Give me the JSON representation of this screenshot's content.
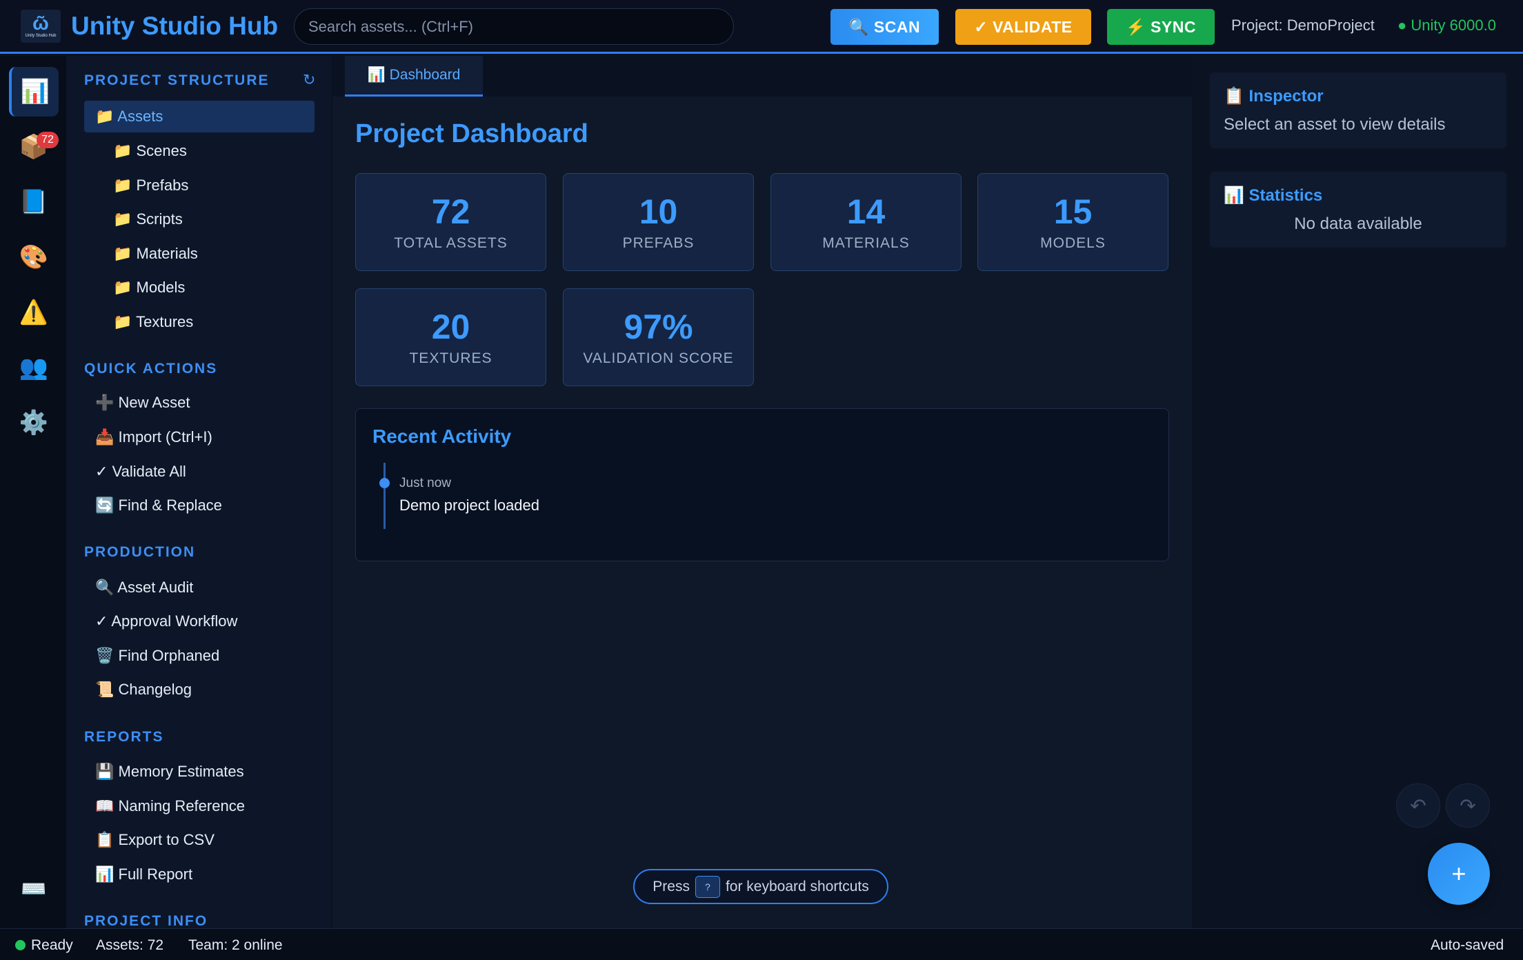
{
  "header": {
    "logo_text": "Unity Studio Hub",
    "title": "Unity Studio Hub",
    "search_placeholder": "Search assets... (Ctrl+F)",
    "scan_label": "🔍 SCAN",
    "validate_label": "✓ VALIDATE",
    "sync_label": "⚡ SYNC",
    "project": "Project: DemoProject",
    "unity_version": "● Unity 6000.0"
  },
  "rail": {
    "items": [
      {
        "icon": "📊",
        "name": "dashboard-icon"
      },
      {
        "icon": "📦",
        "name": "assets-icon",
        "badge": "72"
      },
      {
        "icon": "📘",
        "name": "docs-icon"
      },
      {
        "icon": "🎨",
        "name": "palette-icon"
      },
      {
        "icon": "⚠️",
        "name": "warning-icon"
      },
      {
        "icon": "👥",
        "name": "team-icon"
      },
      {
        "icon": "⚙️",
        "name": "gear-icon"
      }
    ],
    "keyboard_icon": "⌨️"
  },
  "sidebar": {
    "project_structure_title": "PROJECT STRUCTURE",
    "refresh_icon": "↻",
    "tree": [
      "📁 Assets",
      "📁 Scenes",
      "📁 Prefabs",
      "📁 Scripts",
      "📁 Materials",
      "📁 Models",
      "📁 Textures"
    ],
    "quick_actions_title": "QUICK ACTIONS",
    "quick_actions": [
      "➕ New Asset",
      "📥 Import (Ctrl+I)",
      "✓ Validate All",
      "🔄 Find & Replace"
    ],
    "production_title": "PRODUCTION",
    "production": [
      "🔍 Asset Audit",
      "✓ Approval Workflow",
      "🗑️ Find Orphaned",
      "📜 Changelog"
    ],
    "reports_title": "REPORTS",
    "reports": [
      "💾 Memory Estimates",
      "📖 Naming Reference",
      "📋 Export to CSV",
      "📊 Full Report"
    ],
    "project_info_title": "PROJECT INFO"
  },
  "main": {
    "tab_label": "📊 Dashboard",
    "page_title": "Project Dashboard",
    "stats": [
      {
        "value": "72",
        "label": "TOTAL ASSETS"
      },
      {
        "value": "10",
        "label": "PREFABS"
      },
      {
        "value": "14",
        "label": "MATERIALS"
      },
      {
        "value": "15",
        "label": "MODELS"
      },
      {
        "value": "20",
        "label": "TEXTURES"
      },
      {
        "value": "97%",
        "label": "VALIDATION SCORE"
      }
    ],
    "activity_title": "Recent Activity",
    "activity": [
      {
        "time": "Just now",
        "text": "Demo project loaded"
      }
    ],
    "hint_prefix": "Press",
    "hint_key": "?",
    "hint_suffix": "for keyboard shortcuts"
  },
  "right_panel": {
    "inspector_title": "📋 Inspector",
    "inspector_body": "Select an asset to view details",
    "statistics_title": "📊 Statistics",
    "statistics_body": "No data available",
    "undo_icon": "↶",
    "redo_icon": "↷",
    "fab_icon": "+"
  },
  "status": {
    "ready": "Ready",
    "assets": "Assets: 72",
    "team": "Team: 2 online",
    "saved": "Auto-saved"
  }
}
